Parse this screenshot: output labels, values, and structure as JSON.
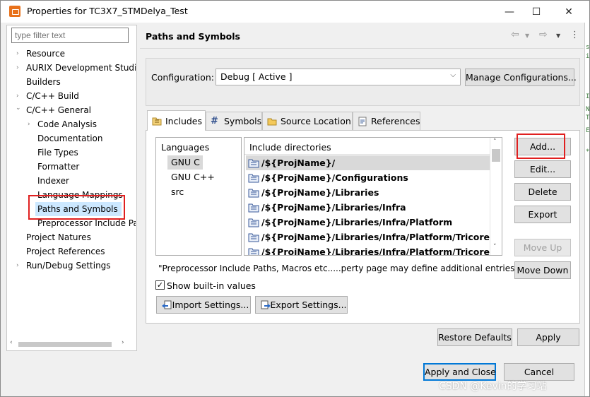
{
  "window": {
    "title": "Properties for TC3X7_STMDelya_Test",
    "minimize_glyph": "—",
    "maximize_glyph": "☐",
    "close_glyph": "✕"
  },
  "sidebar": {
    "filter_placeholder": "type filter text",
    "items": [
      {
        "label": "Resource",
        "expander": "›"
      },
      {
        "label": "AURIX Development Studio",
        "expander": "›"
      },
      {
        "label": "Builders",
        "expander": ""
      },
      {
        "label": "C/C++ Build",
        "expander": "›"
      },
      {
        "label": "C/C++ General",
        "expander": "⌄"
      },
      {
        "label": "Code Analysis",
        "expander": "›"
      },
      {
        "label": "Documentation",
        "expander": ""
      },
      {
        "label": "File Types",
        "expander": ""
      },
      {
        "label": "Formatter",
        "expander": ""
      },
      {
        "label": "Indexer",
        "expander": ""
      },
      {
        "label": "Language Mappings",
        "expander": ""
      },
      {
        "label": "Paths and Symbols",
        "expander": "",
        "selected": true
      },
      {
        "label": "Preprocessor Include Paths",
        "expander": ""
      },
      {
        "label": "Project Natures",
        "expander": ""
      },
      {
        "label": "Project References",
        "expander": ""
      },
      {
        "label": "Run/Debug Settings",
        "expander": "›"
      }
    ]
  },
  "main": {
    "title": "Paths and Symbols",
    "configuration_label": "Configuration:",
    "configuration_value": "Debug  [ Active ]",
    "manage_configurations_label": "Manage Configurations...",
    "tabs": [
      {
        "label": "Includes",
        "icon": "includes-icon",
        "active": true
      },
      {
        "label": "Symbols",
        "icon": "hash-icon",
        "active": false
      },
      {
        "label": "Source Location",
        "icon": "folder-icon",
        "active": false
      },
      {
        "label": "References",
        "icon": "references-icon",
        "active": false
      }
    ],
    "languages_header": "Languages",
    "languages": [
      "GNU C",
      "GNU C++",
      "src"
    ],
    "include_header": "Include directories",
    "include_dirs": [
      "/${ProjName}/",
      "/${ProjName}/Configurations",
      "/${ProjName}/Libraries",
      "/${ProjName}/Libraries/Infra",
      "/${ProjName}/Libraries/Infra/Platform",
      "/${ProjName}/Libraries/Infra/Platform/Tricore",
      "/${ProjName}/Libraries/Infra/Platform/Tricore/Compilers"
    ],
    "buttons": {
      "add": "Add...",
      "edit": "Edit...",
      "delete": "Delete",
      "export": "Export",
      "move_up": "Move Up",
      "move_down": "Move Down"
    },
    "note": "\"Preprocessor Include Paths, Macros etc.....perty page may define additional entries",
    "show_builtin_label": "Show built-in values",
    "show_builtin_checked": "✓",
    "import_settings_label": "Import Settings...",
    "export_settings_label": "Export Settings...",
    "restore_defaults_label": "Restore Defaults",
    "apply_label": "Apply"
  },
  "footer": {
    "apply_close_label": "Apply and Close",
    "cancel_label": "Cancel"
  },
  "watermark": "CSDN @Kevin的学习站",
  "colors": {
    "highlight_red": "#e02020",
    "selection_blue": "#cce8ff",
    "primary_button_border": "#0078d7",
    "app_icon_orange": "#e8711a"
  }
}
